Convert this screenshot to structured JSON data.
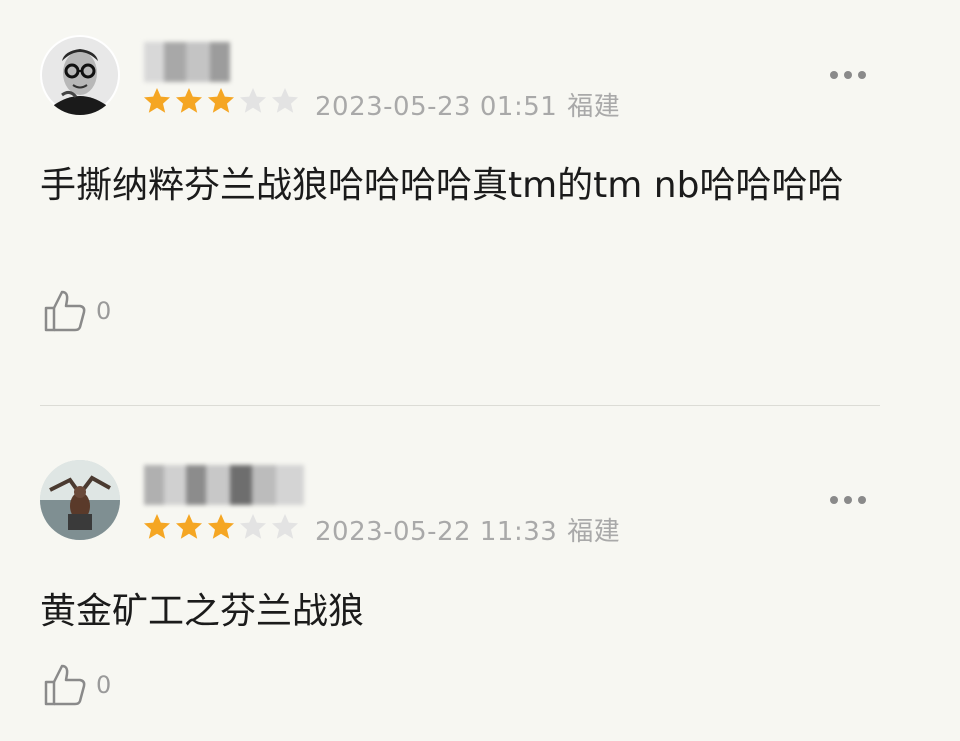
{
  "reviews": [
    {
      "rating": 3,
      "max_rating": 5,
      "date": "2023-05-23 01:51",
      "location": "福建",
      "text": "手撕纳粹芬兰战狼哈哈哈哈真tm的tm nb哈哈哈哈",
      "likes": "0",
      "avatar_icon": "bespectacled-man-avatar",
      "more_icon": "more-dots-icon"
    },
    {
      "rating": 3,
      "max_rating": 5,
      "date": "2023-05-22 11:33",
      "location": "福建",
      "text": "黄金矿工之芬兰战狼",
      "likes": "0",
      "avatar_icon": "movie-scene-avatar",
      "more_icon": "more-dots-icon"
    }
  ],
  "colors": {
    "star_filled": "#f5a623",
    "star_empty": "#e3e3e3",
    "background": "#f7f7f2"
  }
}
